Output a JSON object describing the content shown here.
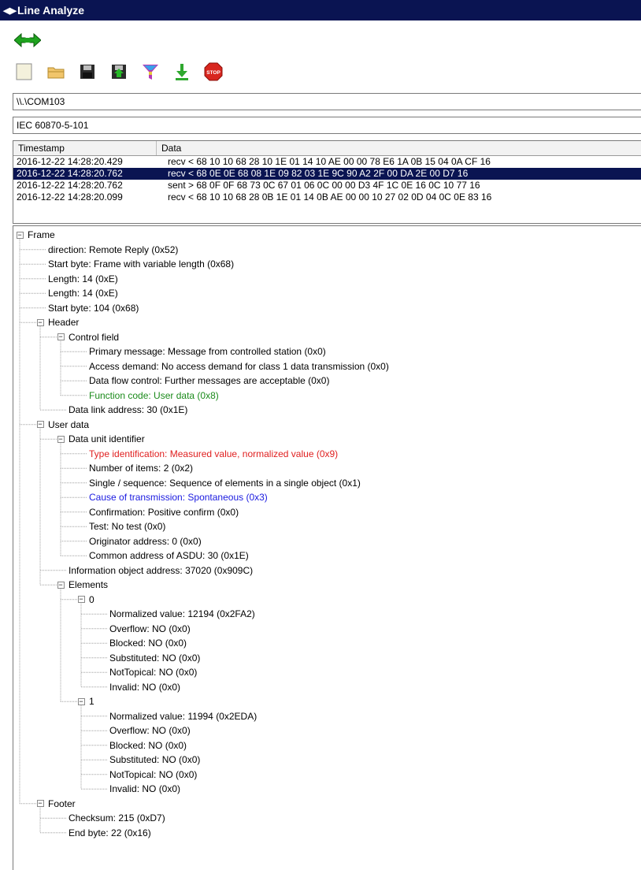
{
  "window": {
    "title": "Line Analyze",
    "title_icon": "double-arrow-icon"
  },
  "toolbar": {
    "tools": [
      {
        "name": "new",
        "icon": "new-file-icon"
      },
      {
        "name": "open",
        "icon": "open-folder-icon"
      },
      {
        "name": "save",
        "icon": "save-disk-icon"
      },
      {
        "name": "export",
        "icon": "export-disk-icon"
      },
      {
        "name": "filter",
        "icon": "filter-icon"
      },
      {
        "name": "download",
        "icon": "download-arrow-icon"
      },
      {
        "name": "stop",
        "icon": "stop-sign-icon",
        "label": "STOP"
      }
    ]
  },
  "port": {
    "value": "\\\\.\\COM103"
  },
  "protocol": {
    "value": "IEC 60870-5-101"
  },
  "table": {
    "columns": [
      "Timestamp",
      "Data"
    ],
    "rows": [
      {
        "timestamp": "2016-12-22 14:28:20.429",
        "data": "recv < 68 10 10 68 28 10 1E 01 14 10 AE 00 00 78 E6 1A 0B 15 04 0A CF 16",
        "selected": false
      },
      {
        "timestamp": "2016-12-22 14:28:20.762",
        "data": "recv < 68 0E 0E 68 08 1E 09 82 03 1E 9C 90 A2 2F 00 DA 2E 00 D7 16",
        "selected": true
      },
      {
        "timestamp": "2016-12-22 14:28:20.762",
        "data": "sent > 68 0F 0F 68 73 0C 67 01 06 0C 00 00 D3 4F 1C 0E 16 0C 10 77 16",
        "selected": false
      },
      {
        "timestamp": "2016-12-22 14:28:20.099",
        "data": "recv < 68 10 10 68 28 0B 1E 01 14 0B AE 00 00 10 27 02 0D 04 0C 0E 83 16",
        "selected": false
      }
    ]
  },
  "tree": [
    {
      "text": "Frame",
      "level": 0,
      "expandable": true
    },
    {
      "text": "direction: Remote Reply (0x52)",
      "level": 1
    },
    {
      "text": "Start byte: Frame with variable length (0x68)",
      "level": 1
    },
    {
      "text": "Length: 14 (0xE)",
      "level": 1
    },
    {
      "text": "Length: 14 (0xE)",
      "level": 1
    },
    {
      "text": "Start byte: 104 (0x68)",
      "level": 1
    },
    {
      "text": "Header",
      "level": 1,
      "expandable": true
    },
    {
      "text": "Control field",
      "level": 2,
      "expandable": true
    },
    {
      "text": "Primary message: Message from controlled station (0x0)",
      "level": 3
    },
    {
      "text": "Access demand: No access demand for class 1 data transmission (0x0)",
      "level": 3
    },
    {
      "text": "Data flow control: Further messages are acceptable (0x0)",
      "level": 3
    },
    {
      "text": "Function code: User data (0x8)",
      "level": 3,
      "color": "green"
    },
    {
      "text": "Data link address: 30 (0x1E)",
      "level": 2
    },
    {
      "text": "User data",
      "level": 1,
      "expandable": true
    },
    {
      "text": "Data unit identifier",
      "level": 2,
      "expandable": true
    },
    {
      "text": "Type identification: Measured value, normalized value (0x9)",
      "level": 3,
      "color": "red"
    },
    {
      "text": "Number of items: 2 (0x2)",
      "level": 3
    },
    {
      "text": "Single / sequence: Sequence of elements in a single object (0x1)",
      "level": 3
    },
    {
      "text": "Cause of transmission: Spontaneous (0x3)",
      "level": 3,
      "color": "blue"
    },
    {
      "text": "Confirmation: Positive confirm (0x0)",
      "level": 3
    },
    {
      "text": "Test: No test (0x0)",
      "level": 3
    },
    {
      "text": "Originator address: 0 (0x0)",
      "level": 3
    },
    {
      "text": "Common address of ASDU: 30 (0x1E)",
      "level": 3
    },
    {
      "text": "Information object address: 37020 (0x909C)",
      "level": 2
    },
    {
      "text": "Elements",
      "level": 2,
      "expandable": true
    },
    {
      "text": "0",
      "level": 3,
      "expandable": true
    },
    {
      "text": "Normalized value: 12194 (0x2FA2)",
      "level": 4
    },
    {
      "text": "Overflow: NO (0x0)",
      "level": 4
    },
    {
      "text": "Blocked: NO (0x0)",
      "level": 4
    },
    {
      "text": "Substituted: NO (0x0)",
      "level": 4
    },
    {
      "text": "NotTopical: NO (0x0)",
      "level": 4
    },
    {
      "text": "Invalid: NO (0x0)",
      "level": 4
    },
    {
      "text": "1",
      "level": 3,
      "expandable": true
    },
    {
      "text": "Normalized value: 11994 (0x2EDA)",
      "level": 4
    },
    {
      "text": "Overflow: NO (0x0)",
      "level": 4
    },
    {
      "text": "Blocked: NO (0x0)",
      "level": 4
    },
    {
      "text": "Substituted: NO (0x0)",
      "level": 4
    },
    {
      "text": "NotTopical: NO (0x0)",
      "level": 4
    },
    {
      "text": "Invalid: NO (0x0)",
      "level": 4
    },
    {
      "text": "Footer",
      "level": 1,
      "expandable": true
    },
    {
      "text": "Checksum: 215 (0xD7)",
      "level": 2
    },
    {
      "text": "End byte: 22 (0x16)",
      "level": 2
    }
  ],
  "colors": {
    "selection": "#0a1452",
    "red": "#e02020",
    "green": "#1a8a1a",
    "blue": "#1a1ae0"
  }
}
